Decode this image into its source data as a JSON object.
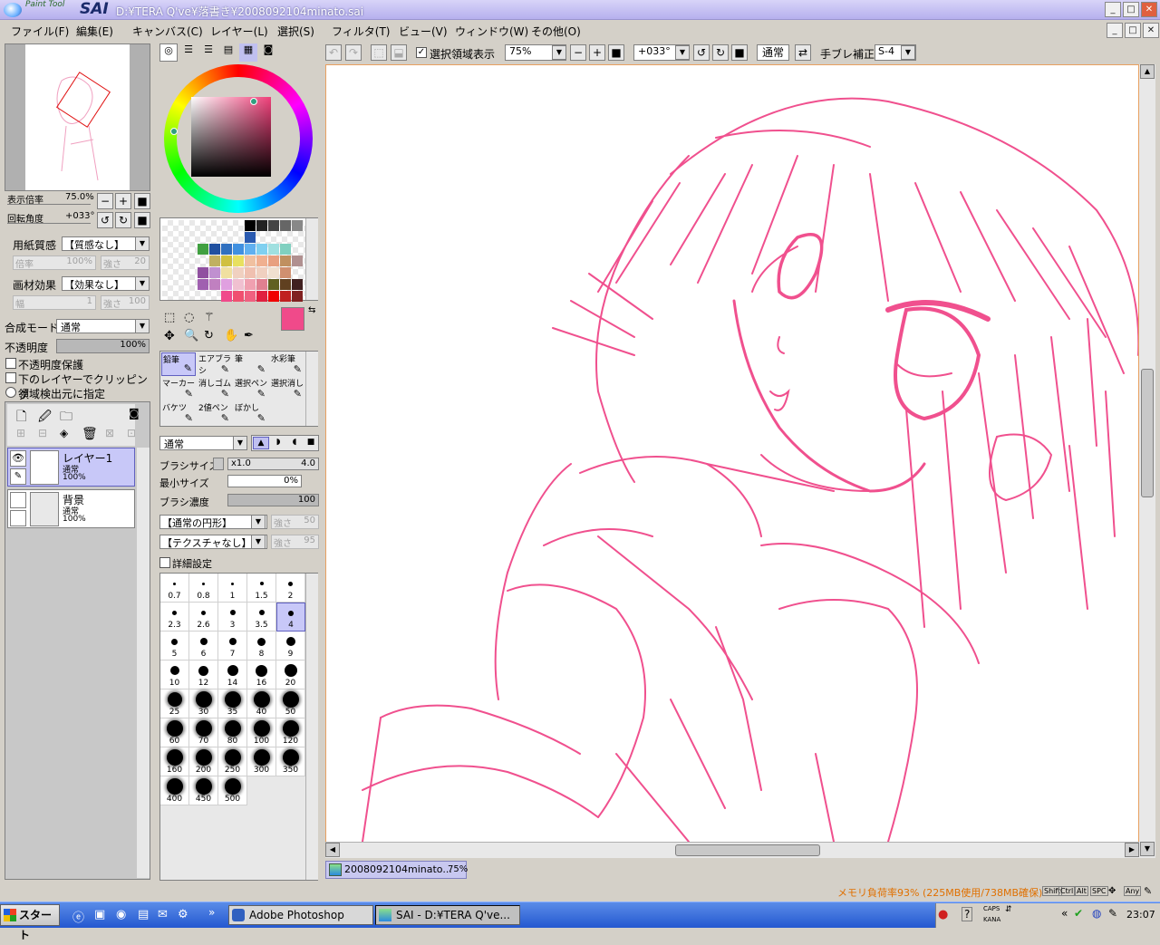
{
  "app": {
    "logo_small": "Paint Tool",
    "logo_big": "SAI",
    "title": "D:¥TERA Q've¥落書き¥2008092104minato.sai"
  },
  "window_buttons": {
    "min": "_",
    "max": "□",
    "close": "✕"
  },
  "menu": [
    "ファイル(F)",
    "編集(E)",
    "キャンバス(C)",
    "レイヤー(L)",
    "選択(S)",
    "フィルタ(T)",
    "ビュー(V)",
    "ウィンドウ(W)",
    "その他(O)"
  ],
  "navigator": {
    "zoom_label": "表示倍率",
    "zoom_value": "75.0%",
    "rotation_label": "回転角度",
    "rotation_value": "+033°"
  },
  "paper": {
    "texture_label": "用紙質感",
    "texture_value": "【質感なし】",
    "scale_label": "倍率",
    "scale_value": "100%",
    "strength_label": "強さ",
    "strength_value": "20",
    "effect_label": "画材効果",
    "effect_value": "【効果なし】",
    "width_label": "幅",
    "width_value": "1",
    "strength2_label": "強さ",
    "strength2_value": "100"
  },
  "blend": {
    "mode_label": "合成モード",
    "mode_value": "通常",
    "opacity_label": "不透明度",
    "opacity_value": "100%",
    "opacity_level": 100
  },
  "layer_options": [
    "不透明度保護",
    "下のレイヤーでクリッピング",
    "領域検出元に指定"
  ],
  "layers": [
    {
      "name": "レイヤー1",
      "mode": "通常",
      "opacity": "100%",
      "selected": true
    },
    {
      "name": "背景",
      "mode": "通常",
      "opacity": "100%",
      "selected": false
    }
  ],
  "tools": [
    [
      "鉛筆",
      "エアブラシ",
      "筆",
      "水彩筆"
    ],
    [
      "マーカー",
      "消しゴム",
      "選択ペン",
      "選択消し"
    ],
    [
      "バケツ",
      "2値ペン",
      "ぼかし",
      ""
    ]
  ],
  "brush": {
    "shape_mode": "通常",
    "size_label": "ブラシサイズ",
    "size_mult": "x1.0",
    "size_value": "4.0",
    "min_size_label": "最小サイズ",
    "min_size_value": "0%",
    "density_label": "ブラシ濃度",
    "density_value": "100",
    "shape_value": "【通常の円形】",
    "shape_strength_label": "強さ",
    "shape_strength_value": "50",
    "texture_value": "【テクスチャなし】",
    "texture_strength_label": "強さ",
    "texture_strength_value": "95",
    "detail_label": "詳細設定"
  },
  "brush_sizes": [
    "0.7",
    "0.8",
    "1",
    "1.5",
    "2",
    "2.3",
    "2.6",
    "3",
    "3.5",
    "4",
    "5",
    "6",
    "7",
    "8",
    "9",
    "10",
    "12",
    "14",
    "16",
    "20",
    "25",
    "30",
    "35",
    "40",
    "50",
    "60",
    "70",
    "80",
    "100",
    "120",
    "160",
    "200",
    "250",
    "300",
    "350",
    "400",
    "450",
    "500"
  ],
  "canvas_toolbar": {
    "show_selection_label": "選択領域表示",
    "zoom_value": "75%",
    "rotation_value": "+033°",
    "blend_value": "通常",
    "stabilizer_label": "手ブレ補正",
    "stabilizer_value": "S-4"
  },
  "document_tab": {
    "name": "2008092104minato...",
    "zoom": "75%"
  },
  "status": {
    "memory": "メモリ負荷率93% (225MB使用/738MB確保)",
    "keys": [
      "Shift",
      "Ctrl",
      "Alt",
      "SPC",
      "Any"
    ]
  },
  "taskbar": {
    "start": "スタート",
    "tasks": [
      "Adobe Photoshop",
      "SAI - D:¥TERA Q've..."
    ],
    "caps": "CAPS",
    "kana": "KANA",
    "clock": "23:07"
  },
  "colors": {
    "accent": "#f04a8a",
    "line_art": "#f0508e",
    "title_bar": "#b6b0ee",
    "taskbar": "#2458d0"
  }
}
